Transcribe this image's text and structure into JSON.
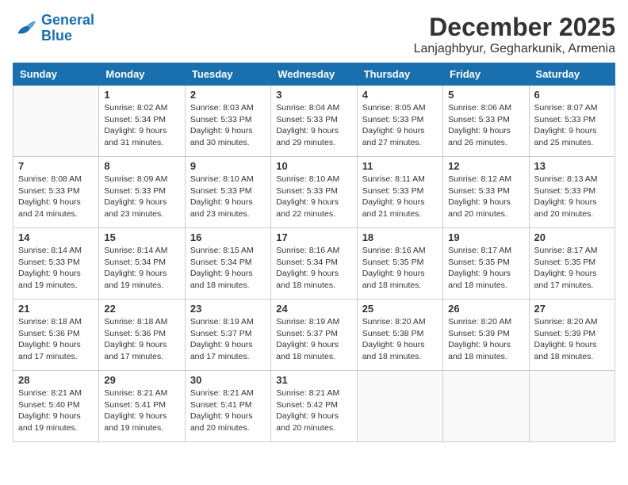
{
  "logo": {
    "text_general": "General",
    "text_blue": "Blue"
  },
  "header": {
    "title": "December 2025",
    "subtitle": "Lanjaghbyur, Gegharkunik, Armenia"
  },
  "weekdays": [
    "Sunday",
    "Monday",
    "Tuesday",
    "Wednesday",
    "Thursday",
    "Friday",
    "Saturday"
  ],
  "weeks": [
    [
      {
        "day": "",
        "info": ""
      },
      {
        "day": "1",
        "info": "Sunrise: 8:02 AM\nSunset: 5:34 PM\nDaylight: 9 hours\nand 31 minutes."
      },
      {
        "day": "2",
        "info": "Sunrise: 8:03 AM\nSunset: 5:33 PM\nDaylight: 9 hours\nand 30 minutes."
      },
      {
        "day": "3",
        "info": "Sunrise: 8:04 AM\nSunset: 5:33 PM\nDaylight: 9 hours\nand 29 minutes."
      },
      {
        "day": "4",
        "info": "Sunrise: 8:05 AM\nSunset: 5:33 PM\nDaylight: 9 hours\nand 27 minutes."
      },
      {
        "day": "5",
        "info": "Sunrise: 8:06 AM\nSunset: 5:33 PM\nDaylight: 9 hours\nand 26 minutes."
      },
      {
        "day": "6",
        "info": "Sunrise: 8:07 AM\nSunset: 5:33 PM\nDaylight: 9 hours\nand 25 minutes."
      }
    ],
    [
      {
        "day": "7",
        "info": "Sunrise: 8:08 AM\nSunset: 5:33 PM\nDaylight: 9 hours\nand 24 minutes."
      },
      {
        "day": "8",
        "info": "Sunrise: 8:09 AM\nSunset: 5:33 PM\nDaylight: 9 hours\nand 23 minutes."
      },
      {
        "day": "9",
        "info": "Sunrise: 8:10 AM\nSunset: 5:33 PM\nDaylight: 9 hours\nand 23 minutes."
      },
      {
        "day": "10",
        "info": "Sunrise: 8:10 AM\nSunset: 5:33 PM\nDaylight: 9 hours\nand 22 minutes."
      },
      {
        "day": "11",
        "info": "Sunrise: 8:11 AM\nSunset: 5:33 PM\nDaylight: 9 hours\nand 21 minutes."
      },
      {
        "day": "12",
        "info": "Sunrise: 8:12 AM\nSunset: 5:33 PM\nDaylight: 9 hours\nand 20 minutes."
      },
      {
        "day": "13",
        "info": "Sunrise: 8:13 AM\nSunset: 5:33 PM\nDaylight: 9 hours\nand 20 minutes."
      }
    ],
    [
      {
        "day": "14",
        "info": "Sunrise: 8:14 AM\nSunset: 5:33 PM\nDaylight: 9 hours\nand 19 minutes."
      },
      {
        "day": "15",
        "info": "Sunrise: 8:14 AM\nSunset: 5:34 PM\nDaylight: 9 hours\nand 19 minutes."
      },
      {
        "day": "16",
        "info": "Sunrise: 8:15 AM\nSunset: 5:34 PM\nDaylight: 9 hours\nand 18 minutes."
      },
      {
        "day": "17",
        "info": "Sunrise: 8:16 AM\nSunset: 5:34 PM\nDaylight: 9 hours\nand 18 minutes."
      },
      {
        "day": "18",
        "info": "Sunrise: 8:16 AM\nSunset: 5:35 PM\nDaylight: 9 hours\nand 18 minutes."
      },
      {
        "day": "19",
        "info": "Sunrise: 8:17 AM\nSunset: 5:35 PM\nDaylight: 9 hours\nand 18 minutes."
      },
      {
        "day": "20",
        "info": "Sunrise: 8:17 AM\nSunset: 5:35 PM\nDaylight: 9 hours\nand 17 minutes."
      }
    ],
    [
      {
        "day": "21",
        "info": "Sunrise: 8:18 AM\nSunset: 5:36 PM\nDaylight: 9 hours\nand 17 minutes."
      },
      {
        "day": "22",
        "info": "Sunrise: 8:18 AM\nSunset: 5:36 PM\nDaylight: 9 hours\nand 17 minutes."
      },
      {
        "day": "23",
        "info": "Sunrise: 8:19 AM\nSunset: 5:37 PM\nDaylight: 9 hours\nand 17 minutes."
      },
      {
        "day": "24",
        "info": "Sunrise: 8:19 AM\nSunset: 5:37 PM\nDaylight: 9 hours\nand 18 minutes."
      },
      {
        "day": "25",
        "info": "Sunrise: 8:20 AM\nSunset: 5:38 PM\nDaylight: 9 hours\nand 18 minutes."
      },
      {
        "day": "26",
        "info": "Sunrise: 8:20 AM\nSunset: 5:39 PM\nDaylight: 9 hours\nand 18 minutes."
      },
      {
        "day": "27",
        "info": "Sunrise: 8:20 AM\nSunset: 5:39 PM\nDaylight: 9 hours\nand 18 minutes."
      }
    ],
    [
      {
        "day": "28",
        "info": "Sunrise: 8:21 AM\nSunset: 5:40 PM\nDaylight: 9 hours\nand 19 minutes."
      },
      {
        "day": "29",
        "info": "Sunrise: 8:21 AM\nSunset: 5:41 PM\nDaylight: 9 hours\nand 19 minutes."
      },
      {
        "day": "30",
        "info": "Sunrise: 8:21 AM\nSunset: 5:41 PM\nDaylight: 9 hours\nand 20 minutes."
      },
      {
        "day": "31",
        "info": "Sunrise: 8:21 AM\nSunset: 5:42 PM\nDaylight: 9 hours\nand 20 minutes."
      },
      {
        "day": "",
        "info": ""
      },
      {
        "day": "",
        "info": ""
      },
      {
        "day": "",
        "info": ""
      }
    ]
  ]
}
